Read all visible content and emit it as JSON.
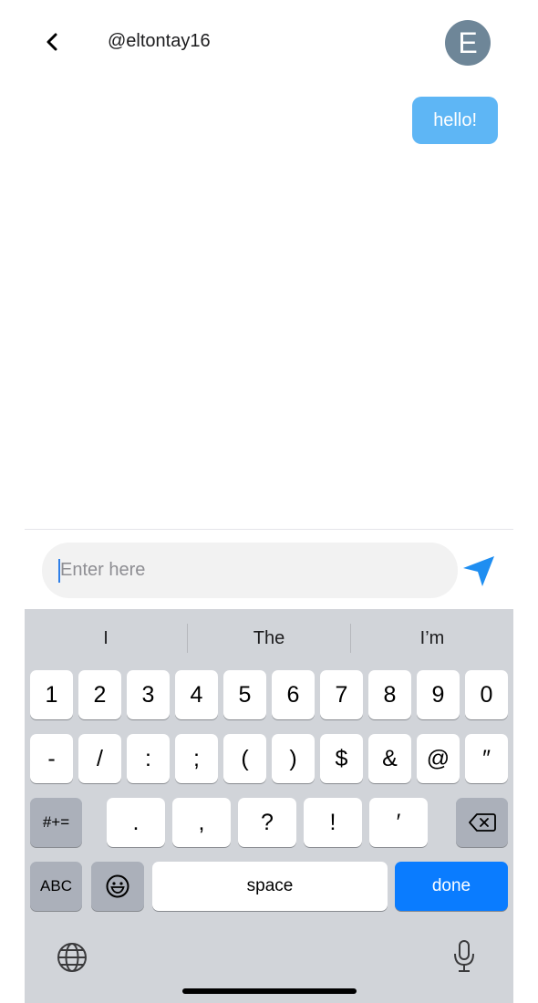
{
  "header": {
    "handle": "@eltontay16",
    "avatar_initial": "E",
    "avatar_color": "#6e8698"
  },
  "messages": [
    {
      "text": "hello!",
      "sender": "me",
      "color": "#5eb6f5"
    }
  ],
  "composer": {
    "placeholder": "Enter here"
  },
  "keyboard": {
    "suggestions": [
      "I",
      "The",
      "I’m"
    ],
    "row1": [
      "1",
      "2",
      "3",
      "4",
      "5",
      "6",
      "7",
      "8",
      "9",
      "0"
    ],
    "row2": [
      "-",
      "/",
      ":",
      ";",
      "(",
      ")",
      "$",
      "&",
      "@",
      "″"
    ],
    "row3": [
      "#+=",
      ".",
      ",",
      "?",
      "!",
      "′"
    ],
    "row4": {
      "abc": "ABC",
      "space": "space",
      "done": "done"
    },
    "accent_color": "#0a7cff"
  }
}
